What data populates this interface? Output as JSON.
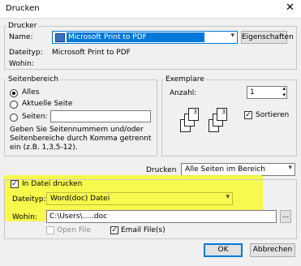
{
  "window": {
    "title": "Drucken",
    "close_glyph": "✕"
  },
  "printer": {
    "group_label": "Drucker",
    "name_label": "Name:",
    "name_value": "Microsoft Print to PDF",
    "properties_button": "Eigenschaften",
    "type_label": "Dateityp:",
    "type_value": "Microsoft Print to PDF",
    "where_label": "Wohin:"
  },
  "range": {
    "group_label": "Seitenbereich",
    "all": "Alles",
    "current": "Aktuelle Seite",
    "pages": "Seiten:",
    "hint": "Geben Sie Seitennummern und/oder Seitenbereiche durch Komma getrennt ein (z.B. 1,3,5-12)."
  },
  "copies": {
    "group_label": "Exemplare",
    "count_label": "Anzahl:",
    "count_value": "1",
    "collate_label": "Sortieren",
    "collate_checked": "✓",
    "page_numbers": [
      "1",
      "2",
      "3",
      "1",
      "2",
      "3"
    ]
  },
  "print_what": {
    "label": "Drucken",
    "value": "Alle Seiten im Bereich"
  },
  "file": {
    "checkbox_label": "In Datei drucken",
    "checked": "✓",
    "type_label": "Dateityp:",
    "type_value": "Word(doc) Datei",
    "where_label": "Wohin:",
    "where_value": "C:\\Users\\.....doc",
    "browse": "...",
    "open_file": "Open File",
    "email_file": "Email File(s)",
    "email_checked": "✓"
  },
  "buttons": {
    "ok": "OK",
    "cancel": "Abbrechen"
  },
  "arrows": {
    "down": "▾",
    "spin_up": "▴",
    "spin_down": "▾"
  },
  "colors": {
    "accent": "#0078d7",
    "highlight": "#f7f93a"
  }
}
